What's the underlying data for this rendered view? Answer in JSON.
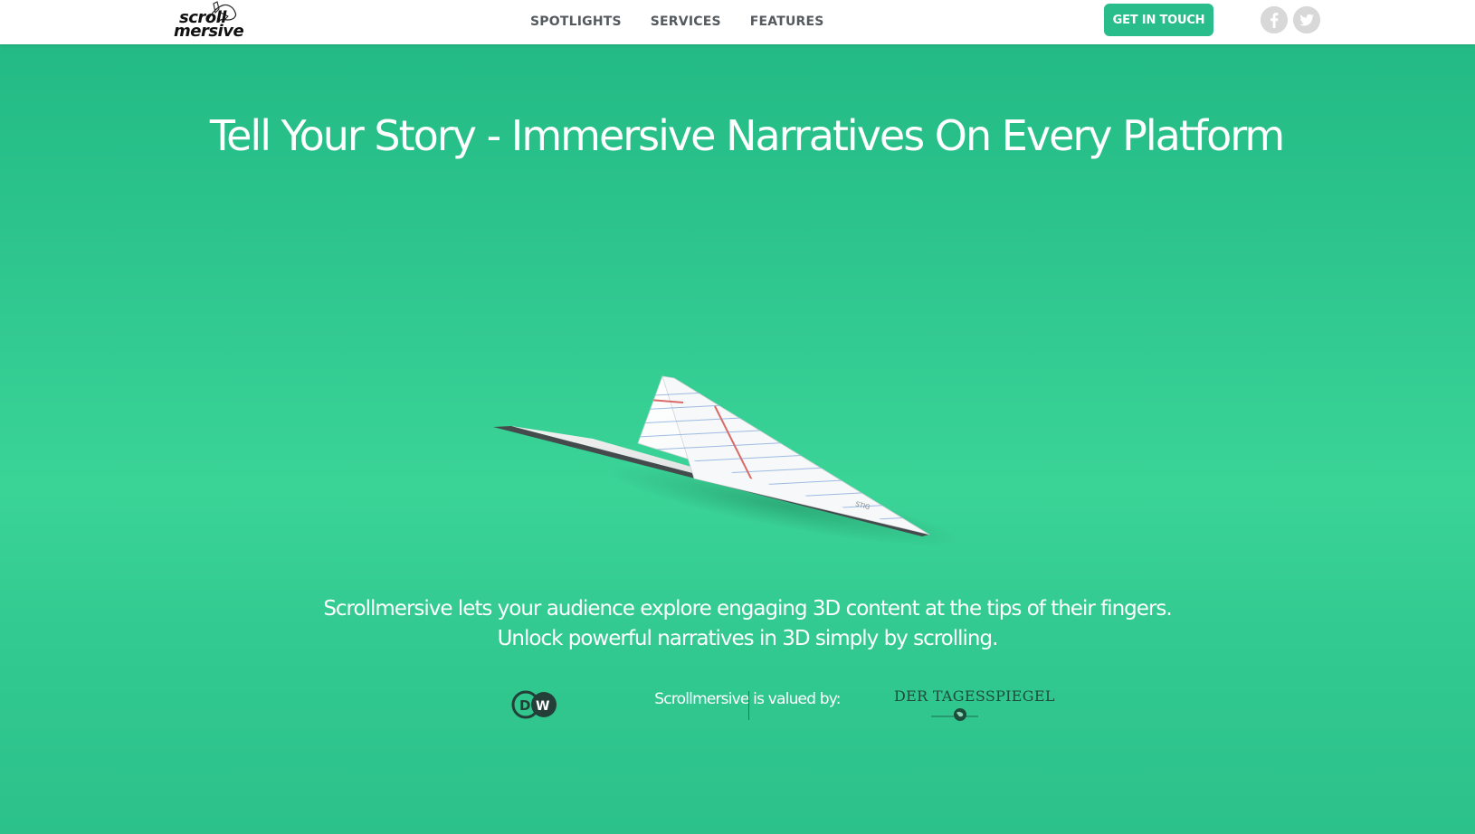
{
  "header": {
    "logo": {
      "line1": "scroll",
      "line2": "mersive"
    },
    "nav": [
      {
        "label": "SPOTLIGHTS"
      },
      {
        "label": "SERVICES"
      },
      {
        "label": "FEATURES"
      }
    ],
    "cta_label": "GET IN TOUCH",
    "social": [
      {
        "icon": "facebook-icon"
      },
      {
        "icon": "twitter-icon"
      }
    ]
  },
  "hero": {
    "title": "Tell Your Story - Immersive Narratives On Every Platform",
    "description_line1": "Scrollmersive lets your audience explore engaging 3D content at the tips of their fingers.",
    "description_line2": "Unlock powerful narratives in 3D simply by scrolling.",
    "valued_by": "Scrollmersive is valued by:",
    "partners": [
      {
        "name": "DW",
        "logo_text": "DW"
      },
      {
        "name": "Der Tagesspiegel",
        "logo_text": "DER TAGESSPIEGEL"
      }
    ]
  },
  "colors": {
    "accent": "#29bd8c",
    "header_bg": "#ffffff",
    "nav_text": "#555a5e",
    "social_bg": "#dcdcdc"
  }
}
